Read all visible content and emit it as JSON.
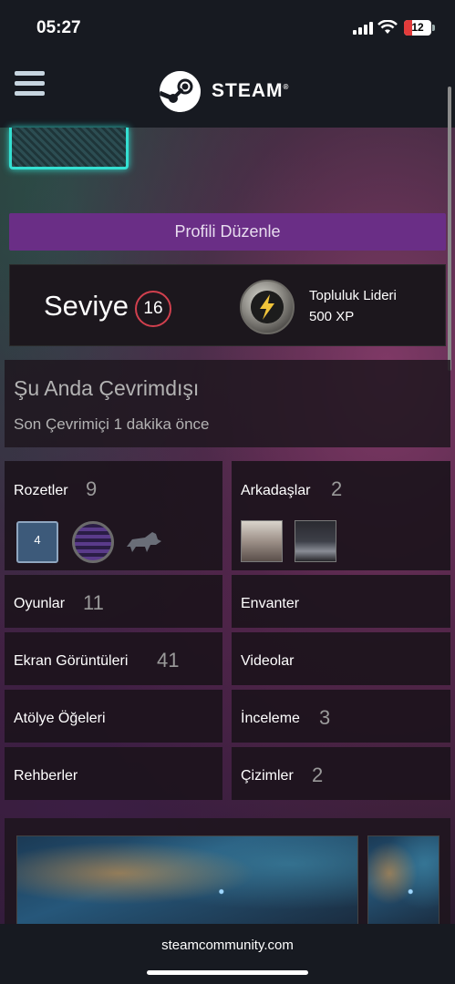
{
  "status_bar": {
    "time": "05:27",
    "battery": "12",
    "icons": [
      "signal-icon",
      "wifi-icon",
      "battery-icon"
    ]
  },
  "header": {
    "logo_text": "STEAM",
    "logo_mark": "®",
    "icons": [
      "menu-icon",
      "steam-logo-icon"
    ]
  },
  "profile": {
    "edit_button": "Profili Düzenle"
  },
  "level": {
    "label": "Seviye",
    "value": "16",
    "badge_title": "Topluluk Lideri",
    "badge_xp": "500 XP"
  },
  "status": {
    "title": "Şu Anda Çevrimdışı",
    "subtitle": "Son Çevrimiçi 1 dakika önce"
  },
  "stats": {
    "badges": {
      "label": "Rozetler",
      "count": "9",
      "first_badge_text": "4"
    },
    "friends": {
      "label": "Arkadaşlar",
      "count": "2"
    },
    "games": {
      "label": "Oyunlar",
      "count": "11"
    },
    "inventory": {
      "label": "Envanter"
    },
    "screenshots": {
      "label": "Ekran Görüntüleri",
      "count": "41"
    },
    "videos": {
      "label": "Videolar"
    },
    "workshop": {
      "label": "Atölye Öğeleri"
    },
    "reviews": {
      "label": "İnceleme",
      "count": "3"
    },
    "guides": {
      "label": "Rehberler"
    },
    "artwork": {
      "label": "Çizimler",
      "count": "2"
    }
  },
  "bottom": {
    "url": "steamcommunity.com"
  },
  "colors": {
    "accent_purple": "#6a2e86",
    "level_ring": "#d1404e",
    "header_bg": "#171a21",
    "frame_cyan": "#34e0d2"
  }
}
